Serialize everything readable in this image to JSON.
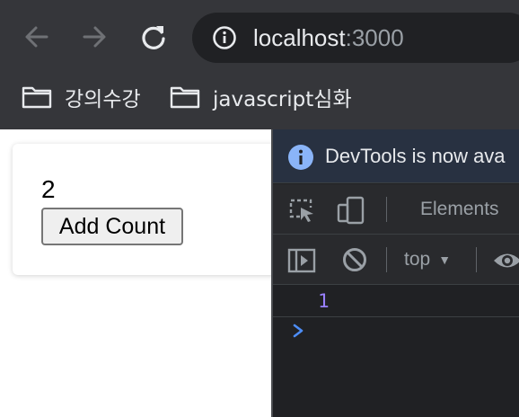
{
  "browser": {
    "url_host": "localhost",
    "url_port": ":3000",
    "bookmarks": [
      {
        "label": "강의수강"
      },
      {
        "label": "javascript심화"
      }
    ],
    "icons": {
      "back": "arrow-left-icon",
      "forward": "arrow-right-icon",
      "reload": "reload-icon",
      "site_info": "info-icon",
      "bookmark_folder": "folder-icon"
    }
  },
  "app": {
    "count": "2",
    "button_label": "Add Count"
  },
  "devtools": {
    "info_message": "DevTools is now ava",
    "tabs": [
      {
        "label": "Elements"
      }
    ],
    "context_select": "top",
    "console_logs": [
      {
        "value": "1"
      }
    ],
    "colors": {
      "background": "#202124",
      "infobar": "#283141",
      "log_number": "#9980ff",
      "prompt": "#4d8df6",
      "info_icon": "#8ab4f8"
    }
  }
}
